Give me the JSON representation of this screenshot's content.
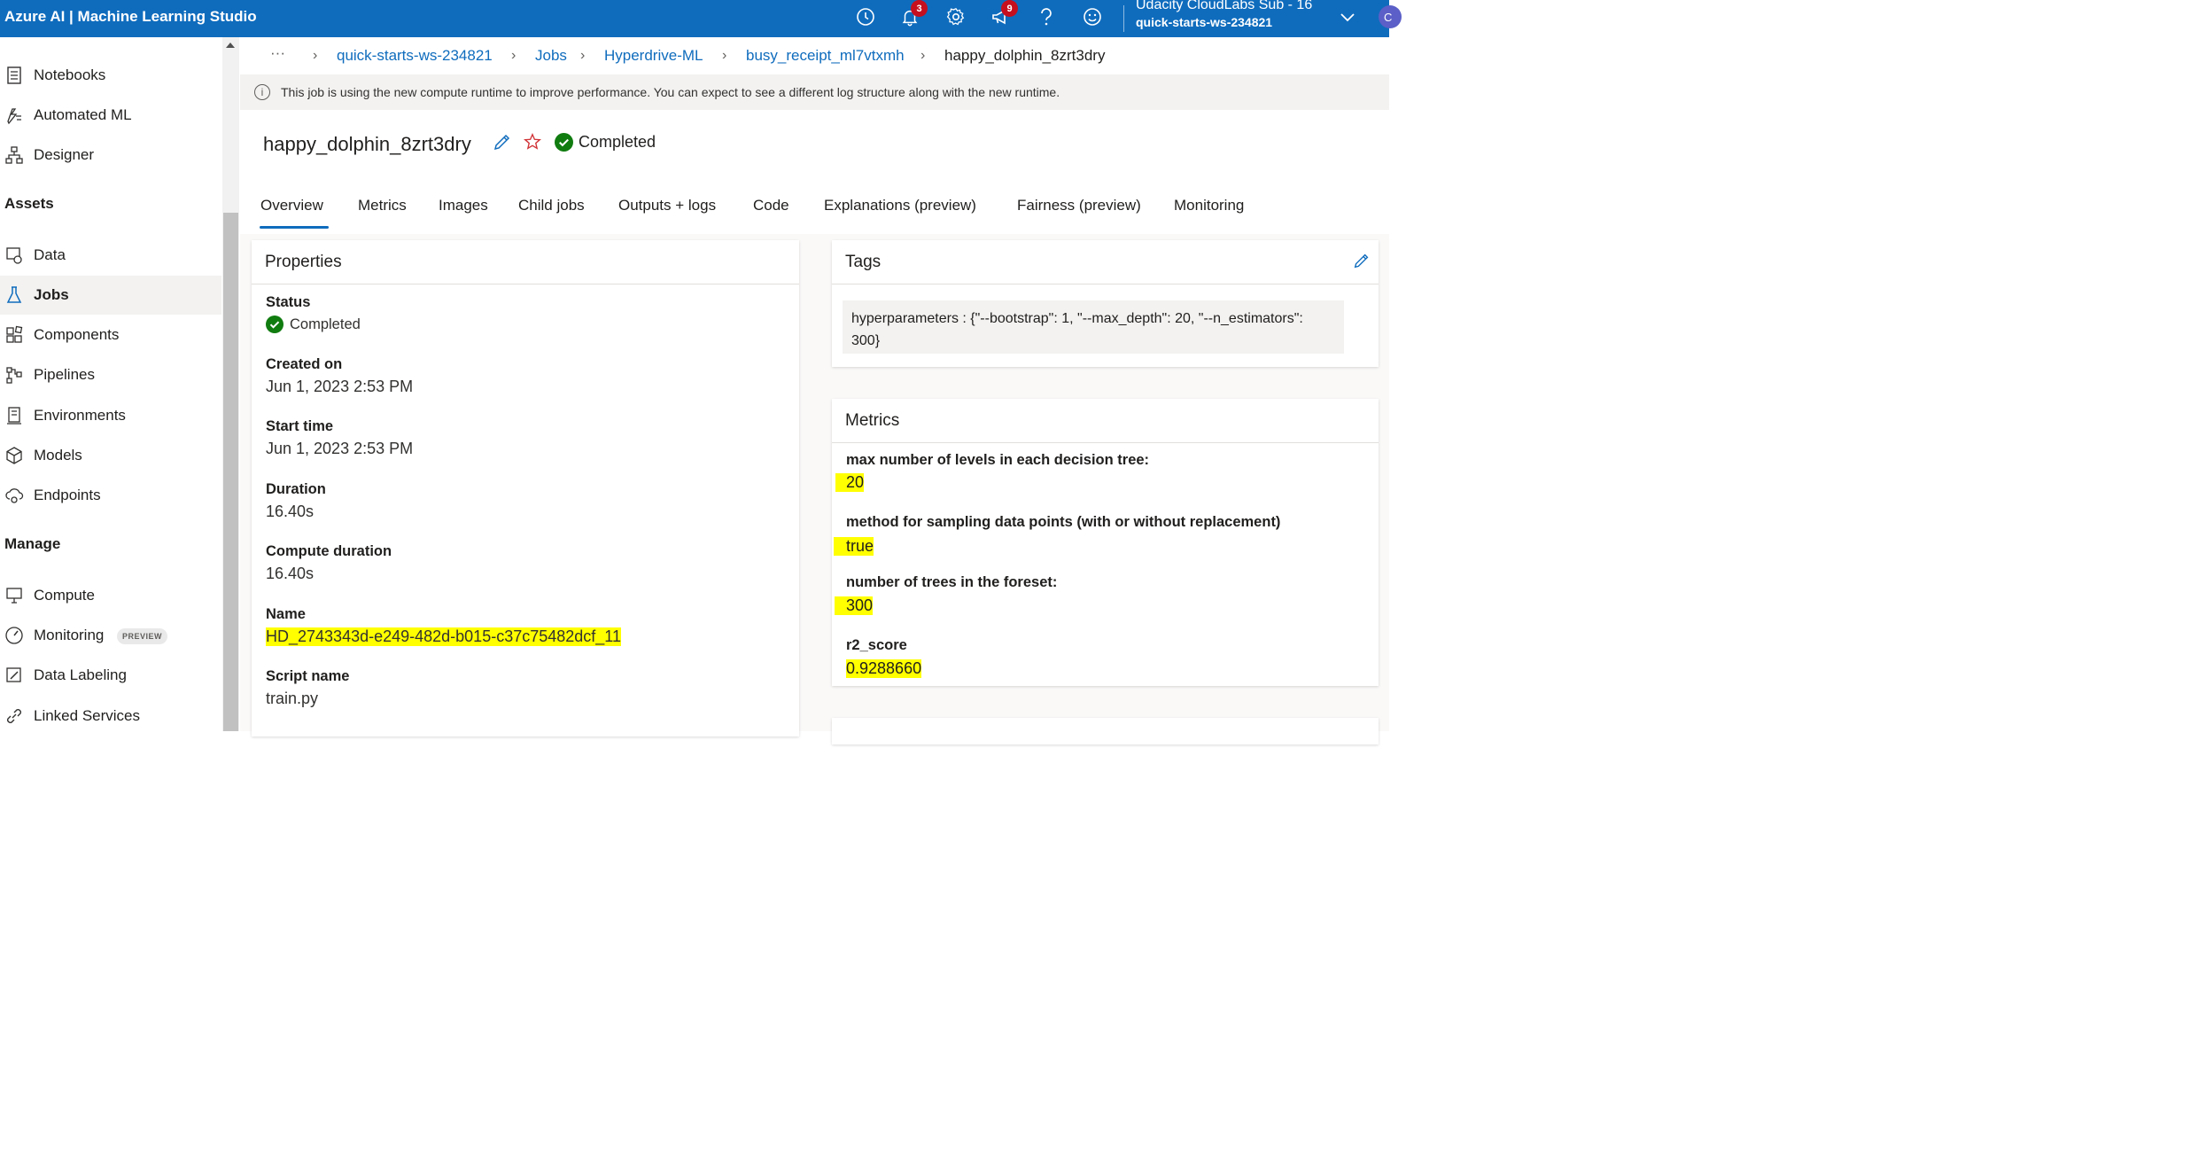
{
  "topbar": {
    "app_title": "Azure AI | Machine Learning Studio",
    "notifications_count": "3",
    "announcements_count": "9",
    "account_name": "Udacity CloudLabs Sub - 16",
    "workspace": "quick-starts-ws-234821",
    "avatar_initial": "C",
    "color": "#0f6cbd"
  },
  "sidebar": {
    "items": [
      {
        "label": "Notebooks",
        "icon": "notebook-icon"
      },
      {
        "label": "Automated ML",
        "icon": "automl-icon"
      },
      {
        "label": "Designer",
        "icon": "designer-icon"
      },
      {
        "label": "Data",
        "icon": "data-icon"
      },
      {
        "label": "Jobs",
        "icon": "flask-icon"
      },
      {
        "label": "Components",
        "icon": "components-icon"
      },
      {
        "label": "Pipelines",
        "icon": "pipelines-icon"
      },
      {
        "label": "Environments",
        "icon": "environments-icon"
      },
      {
        "label": "Models",
        "icon": "cube-icon"
      },
      {
        "label": "Endpoints",
        "icon": "endpoints-icon"
      },
      {
        "label": "Compute",
        "icon": "monitor-icon"
      },
      {
        "label": "Monitoring",
        "icon": "gauge-icon"
      },
      {
        "label": "Data Labeling",
        "icon": "labeling-icon"
      },
      {
        "label": "Linked Services",
        "icon": "link-icon"
      }
    ],
    "section_assets": "Assets",
    "section_manage": "Manage",
    "preview_pill": "PREVIEW",
    "selected": "Jobs"
  },
  "breadcrumb": {
    "ellipsis": "···",
    "items": [
      "quick-starts-ws-234821",
      "Jobs",
      "Hyperdrive-ML",
      "busy_receipt_ml7vtxmh"
    ],
    "current": "happy_dolphin_8zrt3dry"
  },
  "info": {
    "icon": "info-icon",
    "text": "This job is using the new compute runtime to improve performance. You can expect to see a different log structure along with the new runtime."
  },
  "job": {
    "title": "happy_dolphin_8zrt3dry",
    "status": "Completed"
  },
  "tabs": [
    "Overview",
    "Metrics",
    "Images",
    "Child jobs",
    "Outputs + logs",
    "Code",
    "Explanations (preview)",
    "Fairness (preview)",
    "Monitoring"
  ],
  "properties": {
    "title": "Properties",
    "status_label": "Status",
    "status_value": "Completed",
    "created_label": "Created on",
    "created_value": "Jun 1, 2023 2:53 PM",
    "start_label": "Start time",
    "start_value": "Jun 1, 2023 2:53 PM",
    "duration_label": "Duration",
    "duration_value": "16.40s",
    "compute_label": "Compute duration",
    "compute_value": "16.40s",
    "name_label": "Name",
    "name_value": "HD_2743343d-e249-482d-b015-c37c75482dcf_11",
    "script_label": "Script name",
    "script_value": "train.py"
  },
  "tags": {
    "title": "Tags",
    "text": "hyperparameters : {\"--bootstrap\": 1, \"--max_depth\": 20, \"--n_estimators\": 300}"
  },
  "metrics": {
    "title": "Metrics",
    "items": [
      {
        "label": "max number of levels in each decision tree:",
        "value": "20"
      },
      {
        "label": "method for sampling data points (with or without replacement)",
        "value": "true"
      },
      {
        "label": "number of trees in the foreset:",
        "value": "300"
      },
      {
        "label": "r2_score",
        "value": "0.9288660"
      }
    ]
  },
  "colors": {
    "link": "#0f6cbd",
    "success": "#107c10",
    "highlight": "#ffff00",
    "star": "#d13438"
  }
}
